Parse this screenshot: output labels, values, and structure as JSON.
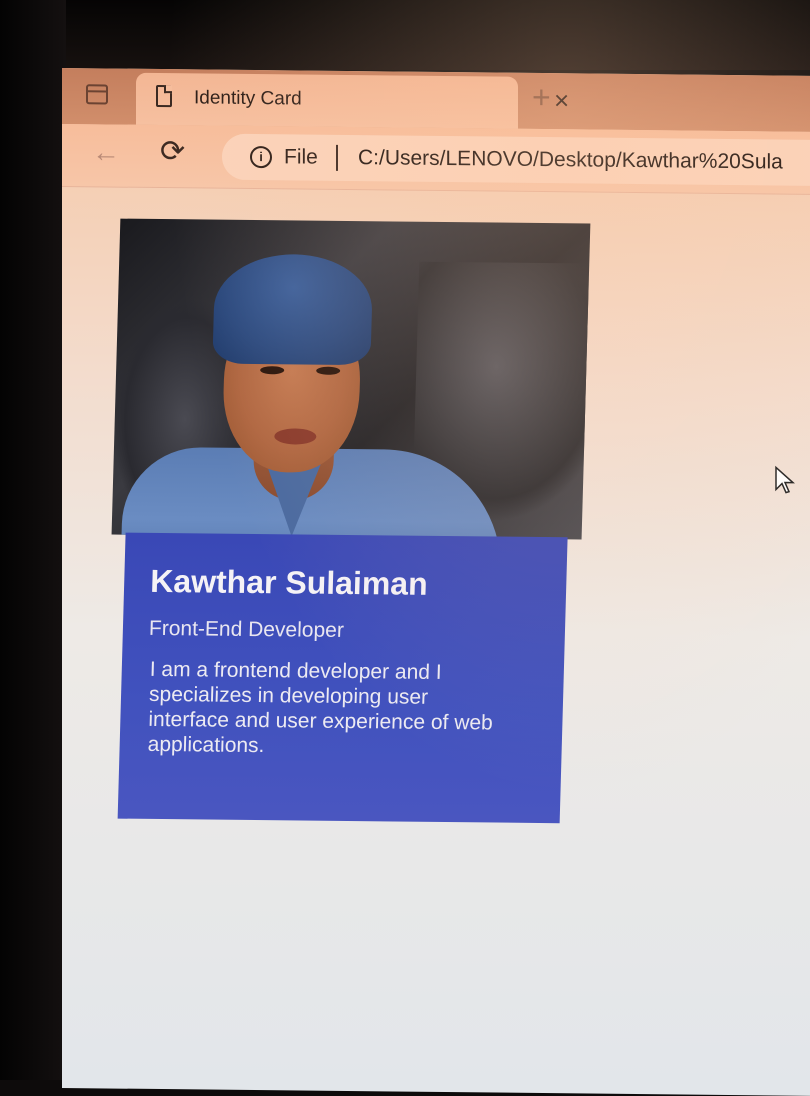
{
  "browser": {
    "tab": {
      "title": "Identity Card",
      "icon": "document-icon",
      "close_glyph": "×"
    },
    "new_tab_glyph": "+",
    "toolbar": {
      "back_glyph": "←",
      "reload_glyph": "⟳",
      "info_glyph": "i",
      "scheme_label": "File",
      "url": "C:/Users/LENOVO/Desktop/Kawthar%20Sula"
    }
  },
  "card": {
    "name": "Kawthar Sulaiman",
    "role": "Front-End Developer",
    "bio": "I am a frontend developer and I specializes in developing user interface and user experience of web applications."
  },
  "colors": {
    "card_blue": "#3f4fbd",
    "tab_bar": "#d18e6b"
  }
}
